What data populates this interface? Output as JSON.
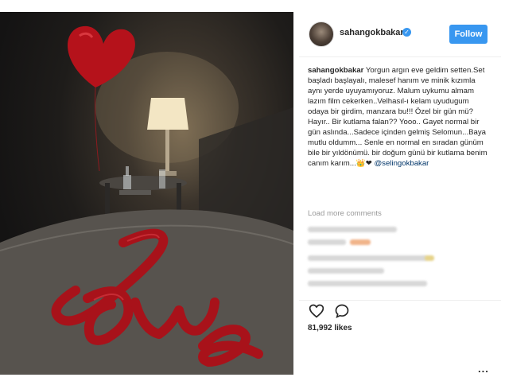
{
  "post": {
    "username": "sahangokbakar",
    "follow_label": "Follow",
    "caption_username": "sahangokbakar",
    "caption_text": "Yorgun argın eve geldim setten.Set başladı başlayalı, malesef hanım ve minik kızımla aynı yerde uyuyamıyoruz. Malum uykumu almam lazım film cekerken..Velhasıl-ı kelam uyudugum odaya bir girdim, manzara bu!!! Özel bir gün mü? Hayır.. Bir kutlama falan?? Yooo.. Gayet normal bir gün aslında...Sadece içinden gelmiş Selomun...Baya mutlu oldumm... Senle en normal en sıradan günüm bile bir yıldönümü. bir doğum günü bir kutlama benim canım karım...",
    "caption_emojis": "👑❤",
    "caption_mention": "@selingokbakar",
    "load_more_label": "Load more comments",
    "likes_label": "81,992 likes",
    "more_label": "..."
  },
  "photo": {
    "description_icons": [
      "heart-balloon",
      "love-balloon",
      "lamp"
    ]
  },
  "colors": {
    "accent": "#3897f0",
    "balloon_red": "#b5121b"
  }
}
